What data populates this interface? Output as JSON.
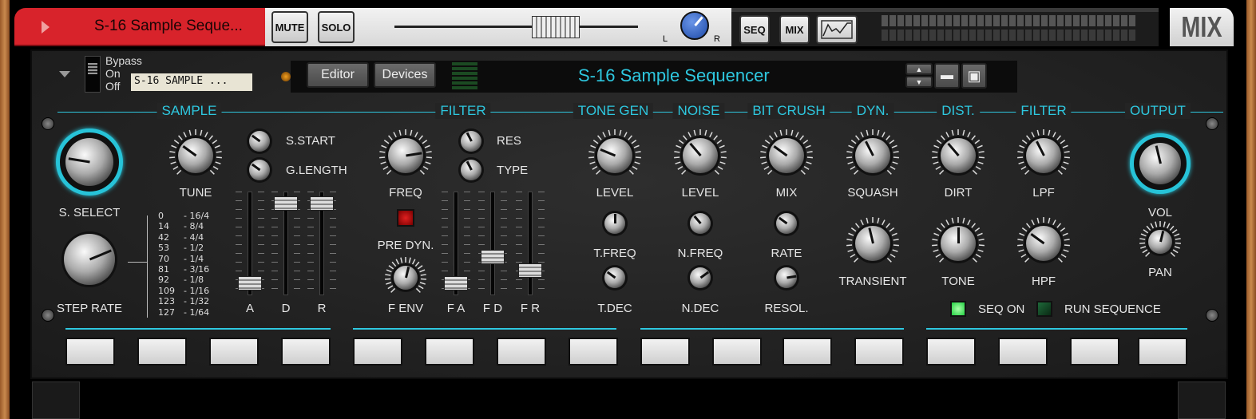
{
  "track": {
    "name": "S-16 Sample Seque...",
    "mute": "MUTE",
    "solo": "SOLO",
    "pan_l": "L",
    "pan_r": "R",
    "seq": "SEQ",
    "mix": "MIX",
    "mix_tab": "MIX",
    "play_icon": "play-triangle-icon",
    "automation_icon": "waveform-icon"
  },
  "device": {
    "bypass": "Bypass",
    "on": "On",
    "off": "Off",
    "patch": "S-16 SAMPLE ...",
    "editor": "Editor",
    "devices": "Devices",
    "title": "S-16 Sample Sequencer"
  },
  "sections": [
    "SAMPLE",
    "FILTER",
    "TONE GEN",
    "NOISE",
    "BIT CRUSH",
    "DYN.",
    "DIST.",
    "FILTER",
    "OUTPUT"
  ],
  "labels": {
    "s_select": "S. SELECT",
    "step_rate": "STEP RATE",
    "tune": "TUNE",
    "s_start": "S.START",
    "g_length": "G.LENGTH",
    "a": "A",
    "d": "D",
    "r": "R",
    "freq": "FREQ",
    "res": "RES",
    "type": "TYPE",
    "pre_dyn": "PRE DYN.",
    "f_env": "F ENV",
    "fa": "F A",
    "fd": "F D",
    "fr": "F R",
    "tg_level": "LEVEL",
    "t_freq": "T.FREQ",
    "t_dec": "T.DEC",
    "n_level": "LEVEL",
    "n_freq": "N.FREQ",
    "n_dec": "N.DEC",
    "mix": "MIX",
    "rate": "RATE",
    "resol": "RESOL.",
    "squash": "SQUASH",
    "transient": "TRANSIENT",
    "dirt": "DIRT",
    "tone": "TONE",
    "lpf": "LPF",
    "hpf": "HPF",
    "vol": "VOL",
    "pan": "PAN",
    "seq_on": "SEQ ON",
    "run_sequence": "RUN SEQUENCE"
  },
  "step_rate_table": [
    [
      "0",
      "- 16/4"
    ],
    [
      "14",
      "- 8/4"
    ],
    [
      "42",
      "- 4/4"
    ],
    [
      "53",
      "- 1/2"
    ],
    [
      "70",
      "- 1/4"
    ],
    [
      "81",
      "- 3/16"
    ],
    [
      "92",
      "- 1/8"
    ],
    [
      "109",
      "- 1/16"
    ],
    [
      "123",
      "- 1/32"
    ],
    [
      "127",
      "- 1/64"
    ]
  ],
  "knob_values": {
    "s_select": 0.2,
    "step_rate": 0.75,
    "tune": 0.3,
    "s_start": 0.3,
    "g_length": 0.3,
    "freq": 0.8,
    "res": 0.4,
    "type": 0.4,
    "f_env": 0.55,
    "tg_level": 0.25,
    "t_freq": 0.5,
    "t_dec": 0.3,
    "n_level": 0.35,
    "n_freq": 0.35,
    "n_dec": 0.7,
    "mix": 0.3,
    "rate": 0.3,
    "resol": 0.8,
    "squash": 0.4,
    "transient": 0.45,
    "dirt": 0.35,
    "tone": 0.5,
    "lpf": 0.4,
    "hpf": 0.3,
    "vol": 0.45,
    "pan": 0.55,
    "pan_track": 0.65
  },
  "fader_values": {
    "a": 0.05,
    "d": 0.95,
    "r": 0.95,
    "fa": 0.05,
    "fd": 0.35,
    "fr": 0.2,
    "track_level": 0.7
  },
  "leds": {
    "seq_on": true,
    "run_sequence": false,
    "filter_env_button": true
  },
  "colors": {
    "accent": "#2ec8e0",
    "track_red": "#d8232b",
    "led_green": "#3cff5a"
  }
}
